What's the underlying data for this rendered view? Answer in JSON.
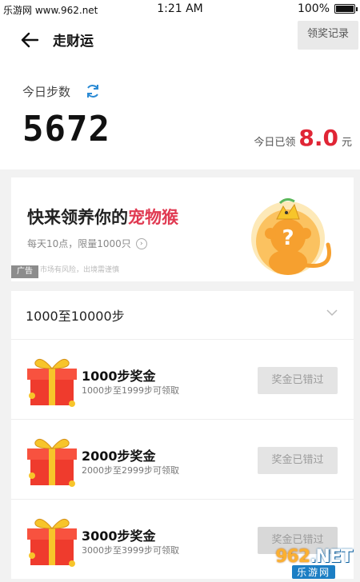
{
  "status_bar": {
    "site_watermark": "乐游网 www.962.net",
    "time": "1:21 AM",
    "battery": "100%"
  },
  "header": {
    "title": "走财运",
    "record_button": "领奖记录"
  },
  "steps": {
    "label": "今日步数",
    "value": "5672",
    "earned_label": "今日已领",
    "earned_value": "8.0",
    "earned_unit": "元"
  },
  "ad": {
    "title_prefix": "快来领养你的",
    "title_highlight": "宠物猴",
    "subtitle": "每天10点，限量1000只",
    "disclaimer": "市场有风险，出境需谨慎",
    "badge": "广告"
  },
  "range": {
    "label": "1000至10000步"
  },
  "rewards": [
    {
      "title": "1000步奖金",
      "subtitle": "1000步至1999步可领取",
      "button": "奖金已错过"
    },
    {
      "title": "2000步奖金",
      "subtitle": "2000步至2999步可领取",
      "button": "奖金已错过"
    },
    {
      "title": "3000步奖金",
      "subtitle": "3000步至3999步可领取",
      "button": "奖金已错过"
    }
  ],
  "watermark": {
    "logo_top": "962",
    "logo_suffix": ".NET",
    "logo_bottom": "乐游网"
  },
  "colors": {
    "accent_red": "#e02535",
    "ad_highlight": "#e03a52",
    "disabled_button_bg": "#e4e4e4"
  }
}
